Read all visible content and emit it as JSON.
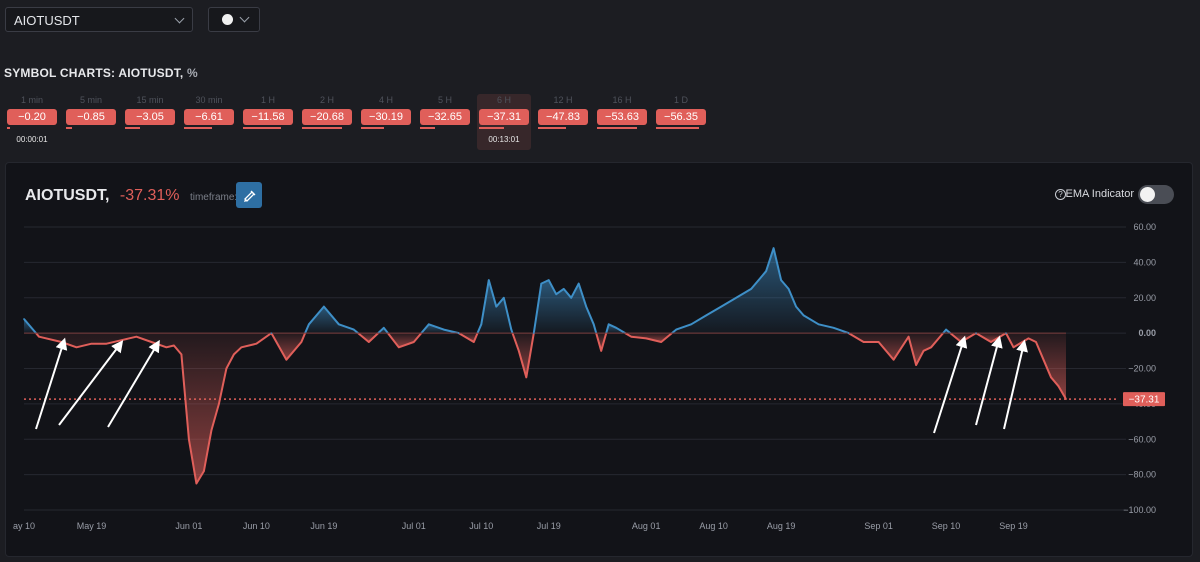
{
  "symbol_select": {
    "value": "AIOTUSDT"
  },
  "section_title": {
    "text": "SYMBOL CHARTS: AIOTUSDT,",
    "unit": "%"
  },
  "timeframes": [
    {
      "label": "1 min",
      "value": "−0.20",
      "timer": "00:00:01"
    },
    {
      "label": "5 min",
      "value": "−0.85"
    },
    {
      "label": "15 min",
      "value": "−3.05"
    },
    {
      "label": "30 min",
      "value": "−6.61"
    },
    {
      "label": "1 H",
      "value": "−11.58"
    },
    {
      "label": "2 H",
      "value": "−20.68"
    },
    {
      "label": "4 H",
      "value": "−30.19"
    },
    {
      "label": "5 H",
      "value": "−32.65"
    },
    {
      "label": "6 H",
      "value": "−37.31",
      "timer": "00:13:01",
      "active": true
    },
    {
      "label": "12 H",
      "value": "−47.83"
    },
    {
      "label": "16 H",
      "value": "−53.63"
    },
    {
      "label": "1 D",
      "value": "−56.35"
    }
  ],
  "chart_header": {
    "symbol": "AIOTUSDT,",
    "change": "-37.31%",
    "timeframe": "timeframe: 6 H"
  },
  "ema": {
    "label": "EMA Indicator",
    "help": "?",
    "enabled": false
  },
  "colors": {
    "positive": "#3e8fc7",
    "negative": "#e05f5a",
    "chip": "#e05f5a"
  },
  "chart_data": {
    "type": "area",
    "x_tick_labels": [
      "ay 10",
      "May 19",
      "Jun 01",
      "Jun 10",
      "Jun 19",
      "Jul 01",
      "Jul 10",
      "Jul 19",
      "Aug 01",
      "Aug 10",
      "Aug 19",
      "Sep 01",
      "Sep 10",
      "Sep 19"
    ],
    "y_tick_labels": [
      "60.00",
      "40.00",
      "20.00",
      "0.00",
      "−20.00",
      "−40.00",
      "−60.00",
      "−80.00",
      "−100.00"
    ],
    "ylim": [
      -100,
      60
    ],
    "baseline": 0,
    "current_value": -37.31,
    "current_label": "−37.31",
    "grid": true,
    "series": [
      {
        "x": [
          "May 10",
          "May 12",
          "May 15",
          "May 17",
          "May 19",
          "May 21",
          "May 23",
          "May 25",
          "May 27",
          "May 29",
          "May 30",
          "May 31",
          "Jun 01",
          "Jun 02",
          "Jun 03",
          "Jun 04",
          "Jun 05",
          "Jun 06",
          "Jun 07",
          "Jun 08",
          "Jun 10",
          "Jun 12",
          "Jun 14",
          "Jun 16",
          "Jun 17",
          "Jun 19",
          "Jun 21",
          "Jun 23",
          "Jun 25",
          "Jun 27",
          "Jun 29",
          "Jul 01",
          "Jul 03",
          "Jul 05",
          "Jul 07",
          "Jul 09",
          "Jul 10",
          "Jul 11",
          "Jul 12",
          "Jul 13",
          "Jul 14",
          "Jul 15",
          "Jul 16",
          "Jul 17",
          "Jul 18",
          "Jul 19",
          "Jul 20",
          "Jul 21",
          "Jul 22",
          "Jul 23",
          "Jul 24",
          "Jul 25",
          "Jul 26",
          "Jul 27",
          "Jul 28",
          "Jul 30",
          "Aug 01",
          "Aug 03",
          "Aug 05",
          "Aug 07",
          "Aug 09",
          "Aug 11",
          "Aug 13",
          "Aug 15",
          "Aug 16",
          "Aug 17",
          "Aug 18",
          "Aug 19",
          "Aug 20",
          "Aug 21",
          "Aug 22",
          "Aug 24",
          "Aug 26",
          "Aug 28",
          "Aug 30",
          "Sep 01",
          "Sep 03",
          "Sep 05",
          "Sep 06",
          "Sep 07",
          "Sep 08",
          "Sep 10",
          "Sep 12",
          "Sep 14",
          "Sep 16",
          "Sep 18",
          "Sep 19",
          "Sep 21",
          "Sep 22",
          "Sep 23",
          "Sep 24",
          "Sep 25",
          "Sep 26"
        ],
        "values": [
          8,
          -2,
          -5,
          -8,
          -6,
          -6,
          -4,
          -2,
          -5,
          -8,
          -7,
          -12,
          -60,
          -85,
          -78,
          -55,
          -40,
          -20,
          -12,
          -8,
          -6,
          0,
          -15,
          -5,
          5,
          15,
          5,
          2,
          -5,
          3,
          -8,
          -5,
          5,
          2,
          0,
          -5,
          5,
          30,
          15,
          20,
          2,
          -10,
          -25,
          0,
          28,
          30,
          22,
          25,
          20,
          28,
          15,
          5,
          -10,
          5,
          3,
          -2,
          -3,
          -5,
          2,
          5,
          10,
          15,
          20,
          25,
          30,
          35,
          48,
          30,
          25,
          15,
          10,
          5,
          3,
          0,
          -5,
          -5,
          -15,
          -2,
          -18,
          -10,
          -8,
          2,
          -5,
          0,
          -5,
          0,
          -8,
          -3,
          -5,
          -15,
          -25,
          -30,
          -37.31
        ]
      }
    ]
  }
}
